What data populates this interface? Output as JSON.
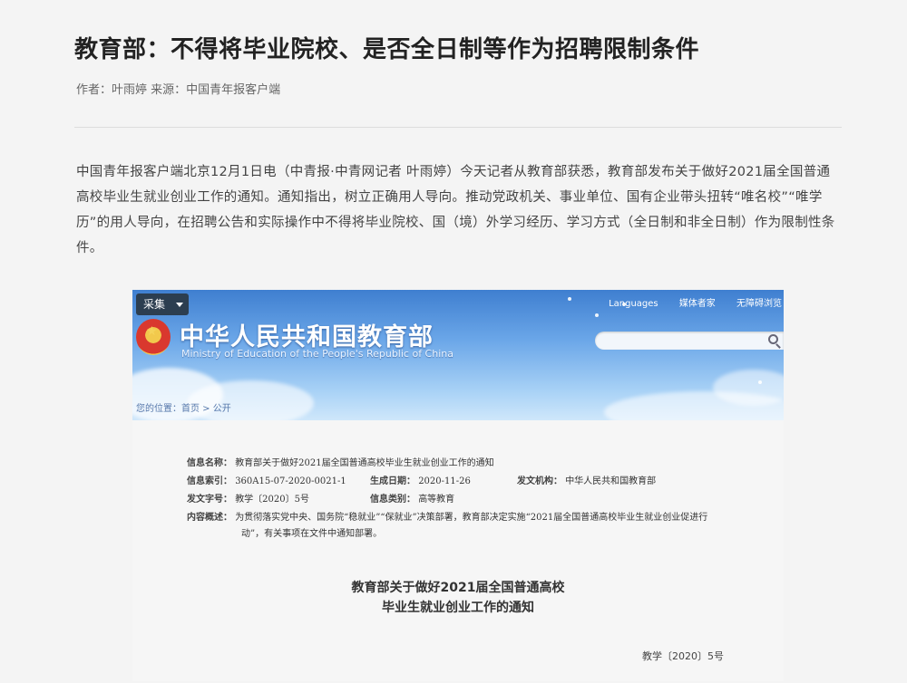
{
  "article": {
    "title": "教育部：不得将毕业院校、是否全日制等作为招聘限制条件",
    "byline": "作者：叶雨婷 来源：中国青年报客户端",
    "body": "中国青年报客户端北京12月1日电（中青报·中青网记者 叶雨婷）今天记者从教育部获悉，教育部发布关于做好2021届全国普通高校毕业生就业创业工作的通知。通知指出，树立正确用人导向。推动党政机关、事业单位、国有企业带头扭转“唯名校”“唯学历”的用人导向，在招聘公告和实际操作中不得将毕业院校、国（境）外学习经历、学习方式（全日制和非全日制）作为限制性条件。"
  },
  "screenshot": {
    "collect_button": "采集",
    "ministry_name_cn": "中华人民共和国教育部",
    "ministry_name_en": "Ministry of Education of the People's Republic of China",
    "top_links": [
      "Languages",
      "媒体者家",
      "无障碍浏览"
    ],
    "breadcrumb": "您的位置：首页 > 公开",
    "info": {
      "name_label": "信息名称：",
      "name_value": "教育部关于做好2021届全国普通高校毕业生就业创业工作的通知",
      "index_label": "信息索引：",
      "index_value": "360A15-07-2020-0021-1",
      "date_label": "生成日期：",
      "date_value": "2020-11-26",
      "org_label": "发文机构：",
      "org_value": "中华人民共和国教育部",
      "docno_label": "发文字号：",
      "docno_value": "教学〔2020〕5号",
      "category_label": "信息类别：",
      "category_value": "高等教育",
      "summary_label": "内容概述：",
      "summary_line1": "为贯彻落实党中央、国务院“稳就业”“保就业”决策部署，教育部决定实施“2021届全国普通高校毕业生就业创业促进行",
      "summary_line2": "动”，有关事项在文件中通知部署。"
    },
    "doc_title_line1": "教育部关于做好2021届全国普通高校",
    "doc_title_line2": "毕业生就业创业工作的通知",
    "doc_number": "教学〔2020〕5号"
  }
}
